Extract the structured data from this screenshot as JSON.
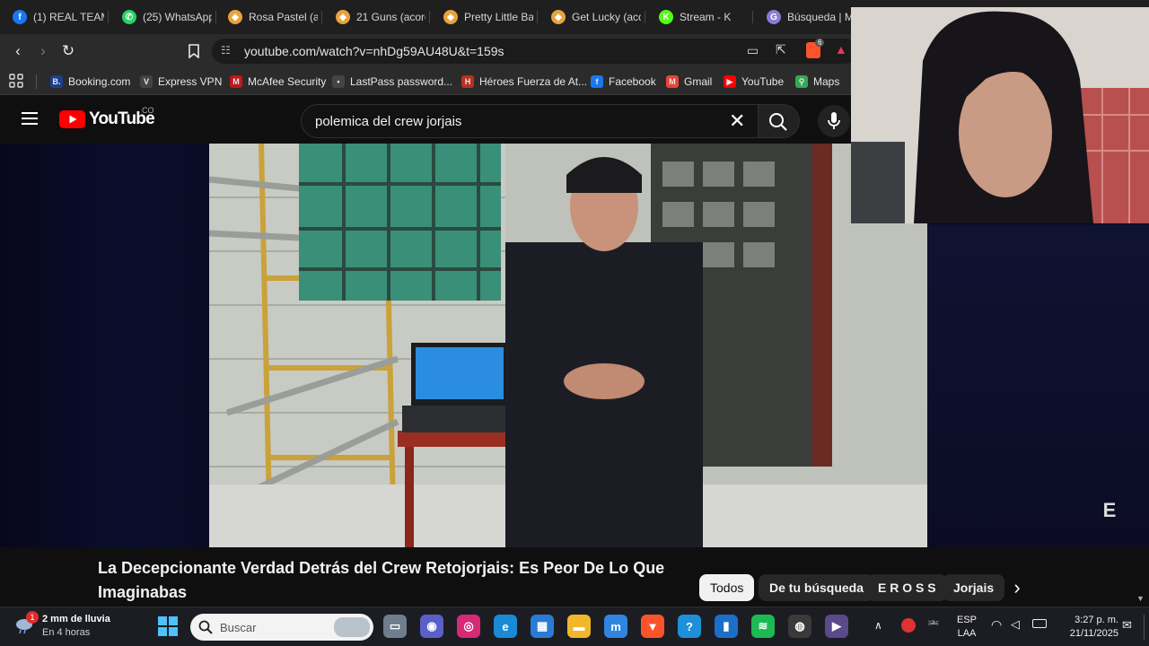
{
  "browser": {
    "tabs": [
      {
        "title": "(1) REAL TEAM",
        "icon": "facebook-icon",
        "color": "#1877f2",
        "glyph": "f"
      },
      {
        "title": "(25) WhatsApp",
        "icon": "whatsapp-icon",
        "color": "#25d366",
        "glyph": "✆"
      },
      {
        "title": "Rosa Pastel (ac",
        "icon": "shield-icon",
        "color": "#e8a33d",
        "glyph": "◆"
      },
      {
        "title": "21 Guns (acorc",
        "icon": "shield-icon",
        "color": "#e8a33d",
        "glyph": "◆"
      },
      {
        "title": "Pretty Little Ba",
        "icon": "shield-icon",
        "color": "#e8a33d",
        "glyph": "◆"
      },
      {
        "title": "Get Lucky (aco",
        "icon": "shield-icon",
        "color": "#e8a33d",
        "glyph": "◆"
      },
      {
        "title": "Stream - K",
        "icon": "kick-icon",
        "color": "#53fc18",
        "glyph": "K"
      },
      {
        "title": "Búsqueda | M",
        "icon": "google-icon",
        "color": "#8b7bd8",
        "glyph": "G"
      }
    ],
    "url": "youtube.com/watch?v=nhDg59AU48U&t=159s",
    "brave_badge": "6",
    "bookmarks": [
      {
        "label": "Booking.com",
        "icon": "booking-icon",
        "color": "#1e3f8e",
        "glyph": "B."
      },
      {
        "label": "Express VPN",
        "icon": "vpn-icon",
        "color": "#444",
        "glyph": "V"
      },
      {
        "label": "McAfee Security",
        "icon": "mcafee-icon",
        "color": "#c01818",
        "glyph": "M"
      },
      {
        "label": "LastPass password...",
        "icon": "lastpass-icon",
        "color": "#444",
        "glyph": "•"
      },
      {
        "label": "Héroes Fuerza de At...",
        "icon": "game-icon",
        "color": "#b83020",
        "glyph": "H"
      },
      {
        "label": "Facebook",
        "icon": "facebook-icon",
        "color": "#1877f2",
        "glyph": "f"
      },
      {
        "label": "Gmail",
        "icon": "gmail-icon",
        "color": "#ea4335",
        "glyph": "M"
      },
      {
        "label": "YouTube",
        "icon": "youtube-icon",
        "color": "#ff0000",
        "glyph": "▶"
      },
      {
        "label": "Maps",
        "icon": "maps-icon",
        "color": "#34a853",
        "glyph": "⚲"
      }
    ]
  },
  "youtube": {
    "logo_text": "YouTube",
    "country_code": "CO",
    "search_query": "polemica del crew jorjais",
    "video_title": "La Decepcionante Verdad Detrás del Crew Retojorjais: Es Peor De Lo Que Imaginabas",
    "chips": [
      "Todos",
      "De tu búsqueda",
      "E R O S S",
      "Jorjais"
    ],
    "watermark": "E"
  },
  "taskbar": {
    "weather_badge": "1",
    "weather_line1": "2 mm de lluvia",
    "weather_line2": "En 4 horas",
    "search_placeholder": "Buscar",
    "lang_line1": "ESP",
    "lang_line2": "LAA",
    "time": "3:27 p. m.",
    "date": "21/11/2025",
    "apps": [
      {
        "name": "task-view-icon",
        "color": "#6f7d8c",
        "glyph": "▭"
      },
      {
        "name": "teams-icon",
        "color": "#5b5fc7",
        "glyph": "◉"
      },
      {
        "name": "instagram-icon",
        "color": "#d62976",
        "glyph": "◎"
      },
      {
        "name": "edge-icon",
        "color": "#1a8ad4",
        "glyph": "e"
      },
      {
        "name": "store-icon",
        "color": "#2a7bd6",
        "glyph": "▦"
      },
      {
        "name": "file-explorer-icon",
        "color": "#f2b728",
        "glyph": "▬"
      },
      {
        "name": "mcafee-app-icon",
        "color": "#2f86e0",
        "glyph": "m"
      },
      {
        "name": "brave-icon",
        "color": "#fb542b",
        "glyph": "▼"
      },
      {
        "name": "help-icon",
        "color": "#1e90d8",
        "glyph": "?"
      },
      {
        "name": "notes-icon",
        "color": "#1c6fc9",
        "glyph": "▮"
      },
      {
        "name": "spotify-icon",
        "color": "#1db954",
        "glyph": "≋"
      },
      {
        "name": "obs-icon",
        "color": "#3a3a3a",
        "glyph": "◍"
      },
      {
        "name": "media-player-icon",
        "color": "#5a4a8a",
        "glyph": "▶"
      }
    ]
  }
}
